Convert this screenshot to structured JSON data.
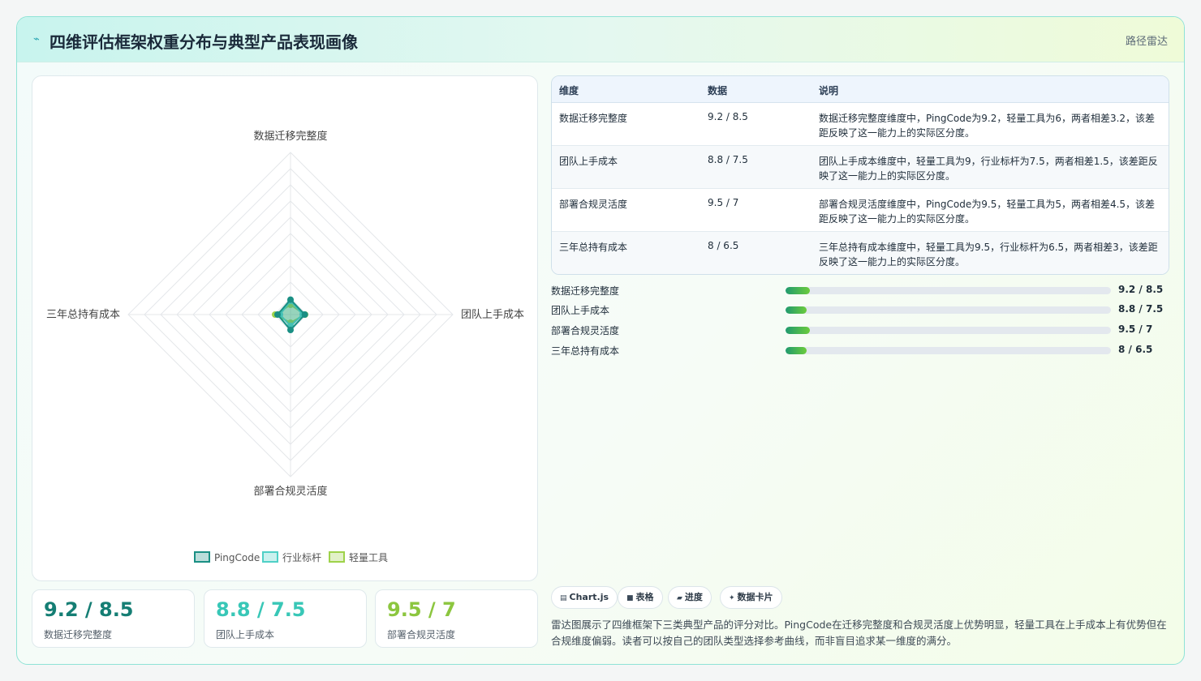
{
  "header": {
    "icon": "line-chart-icon",
    "title": "四维评估框架权重分布与典型产品表现画像",
    "tag": "路径雷达"
  },
  "chart_data": {
    "type": "radar",
    "axes": [
      "数据迁移完整度",
      "团队上手成本",
      "部署合规灵活度",
      "三年总持有成本"
    ],
    "r_range": [
      0,
      100
    ],
    "grid": true,
    "legend_position": "bottom",
    "series": [
      {
        "name": "PingCode",
        "values": [
          9.2,
          8.8,
          9.5,
          8
        ],
        "color": "#1a8f84"
      },
      {
        "name": "行业标杆",
        "values": [
          8.5,
          7.5,
          7,
          6.5
        ],
        "color": "#4fd0c6"
      },
      {
        "name": "轻量工具",
        "values": [
          6,
          9,
          5,
          9.5
        ],
        "color": "#9ed24a"
      }
    ]
  },
  "stats": [
    {
      "value": "9.2 / 8.5",
      "label": "数据迁移完整度",
      "color": "#157e74"
    },
    {
      "value": "8.8 / 7.5",
      "label": "团队上手成本",
      "color": "#38c7b7"
    },
    {
      "value": "9.5 / 7",
      "label": "部署合规灵活度",
      "color": "#8cc63f"
    }
  ],
  "table": {
    "headers": [
      "维度",
      "数据",
      "说明"
    ],
    "rows": [
      {
        "dimension": "数据迁移完整度",
        "data": "9.2 / 8.5",
        "desc": "数据迁移完整度维度中，PingCode为9.2，轻量工具为6，两者相差3.2，该差距反映了这一能力上的实际区分度。"
      },
      {
        "dimension": "团队上手成本",
        "data": "8.8 / 7.5",
        "desc": "团队上手成本维度中，轻量工具为9，行业标杆为7.5，两者相差1.5，该差距反映了这一能力上的实际区分度。"
      },
      {
        "dimension": "部署合规灵活度",
        "data": "9.5 / 7",
        "desc": "部署合规灵活度维度中，PingCode为9.5，轻量工具为5，两者相差4.5，该差距反映了这一能力上的实际区分度。"
      },
      {
        "dimension": "三年总持有成本",
        "data": "8 / 6.5",
        "desc": "三年总持有成本维度中，轻量工具为9.5，行业标杆为6.5，两者相差3，该差距反映了这一能力上的实际区分度。"
      }
    ]
  },
  "bars": [
    {
      "label": "数据迁移完整度",
      "value": "9.2 / 8.5",
      "progress": 0.075
    },
    {
      "label": "团队上手成本",
      "value": "8.8 / 7.5",
      "progress": 0.066
    },
    {
      "label": "部署合规灵活度",
      "value": "9.5 / 7",
      "progress": 0.075
    },
    {
      "label": "三年总持有成本",
      "value": "8 / 6.5",
      "progress": 0.066
    }
  ],
  "chips": [
    {
      "icon": "chart-icon",
      "label": "Chart.js"
    },
    {
      "icon": "table-icon",
      "label": "表格"
    },
    {
      "icon": "progress-icon",
      "label": "进度"
    },
    {
      "icon": "card-icon",
      "label": "数据卡片"
    }
  ],
  "note": "雷达图展示了四维框架下三类典型产品的评分对比。PingCode在迁移完整度和合规灵活度上优势明显，轻量工具在上手成本上有优势但在合规维度偏弱。读者可以按自己的团队类型选择参考曲线，而非盲目追求某一维度的满分。"
}
